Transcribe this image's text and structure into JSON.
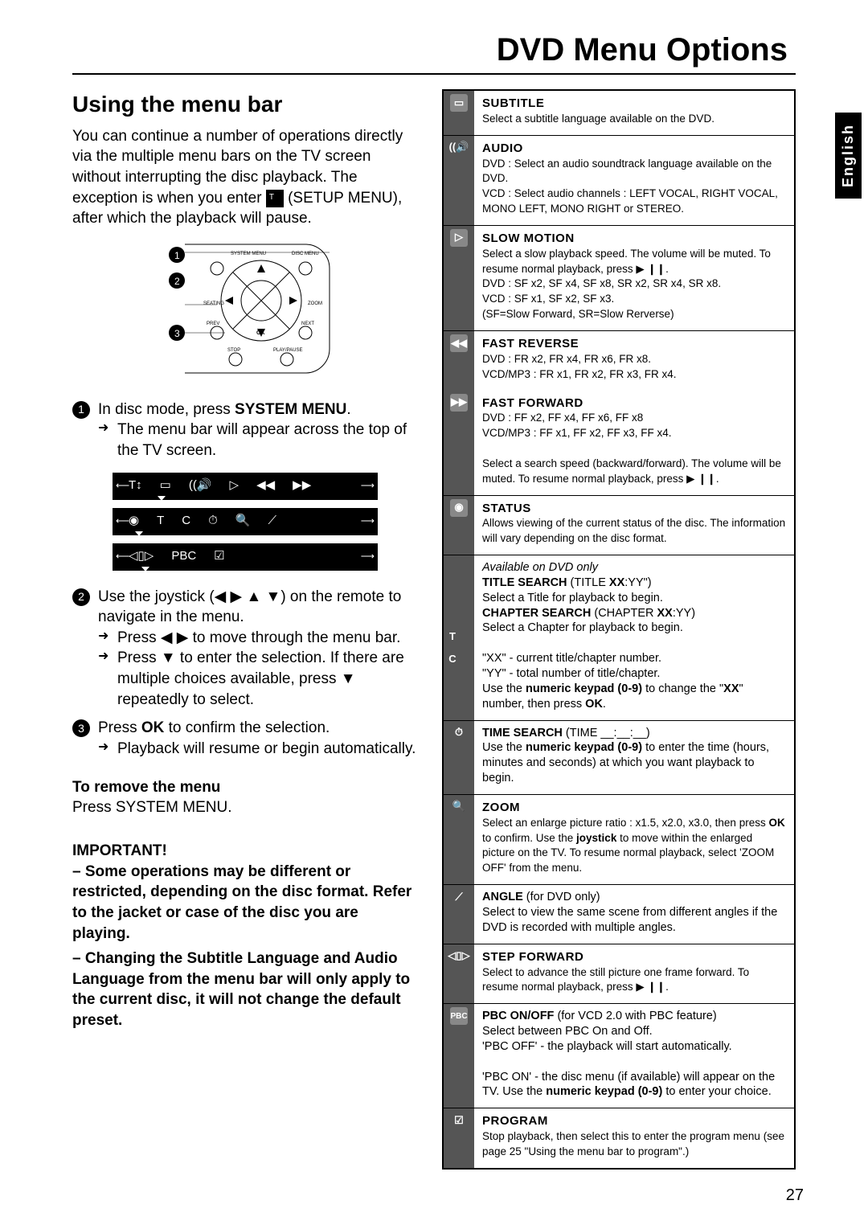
{
  "page_title": "DVD Menu Options",
  "lang_tab": "English",
  "page_number": "27",
  "left": {
    "heading": "Using the menu bar",
    "intro_a": "You can continue a number of operations directly via the multiple menu bars on the TV screen without interrupting the disc playback. The exception is when you enter ",
    "intro_b": " (SETUP MENU), after which the playback will pause.",
    "remote_labels": {
      "sys": "SYSTEM MENU",
      "disc": "DISC MENU",
      "seating": "SEATING",
      "zoom": "ZOOM",
      "prev": "PREV",
      "next": "NEXT",
      "ok": "OK",
      "stop": "STOP",
      "play": "PLAY/PAUSE"
    },
    "step1_a": "In disc mode, press ",
    "step1_a_bold": "SYSTEM MENU",
    "step1_a_end": ".",
    "step1_b": "The menu bar will appear across the top of the TV screen.",
    "step2_a_pre": "Use the joystick (",
    "step2_a_post": ") on the remote to navigate in the menu.",
    "step2_arrows": "◀ ▶ ▲ ▼",
    "step2_b": "Press ◀ ▶ to move through the menu bar.",
    "step2_c": "Press ▼ to enter the selection. If there are multiple choices available, press ▼ repeatedly to select.",
    "step3_a_pre": "Press ",
    "step3_a_bold": "OK",
    "step3_a_post": " to confirm the selection.",
    "step3_b": "Playback will resume or begin automatically.",
    "remove_h": "To remove the menu",
    "remove_body": "Press SYSTEM MENU.",
    "important_h": "IMPORTANT!",
    "important_1": "– Some operations may be different or restricted, depending on the disc format. Refer to the jacket or case of the disc you are playing.",
    "important_2": "– Changing the Subtitle Language and Audio Language from the menu bar will only apply to the current disc, it will not change the default preset."
  },
  "bars": {
    "row1": [
      "T↕",
      "▭",
      "((🔊",
      "▷",
      "◀◀",
      "▶▶"
    ],
    "row2": [
      "◉",
      "T",
      "C",
      "⏱",
      "🔍",
      "⟋"
    ],
    "row3": [
      "◁▯▷",
      "PBC",
      "☑"
    ]
  },
  "options": [
    {
      "icon": "▭",
      "title": "SUBTITLE",
      "body": "Select a subtitle language available on the DVD."
    },
    {
      "icon": "((🔊",
      "title": "AUDIO",
      "body": "DVD : Select an audio soundtrack language available on the DVD.\nVCD : Select audio channels : LEFT VOCAL, RIGHT VOCAL, MONO LEFT, MONO RIGHT or STEREO."
    },
    {
      "icon": "▷",
      "title": "SLOW MOTION",
      "body": "Select a slow playback speed. The volume will be muted. To resume normal playback, press ▶ ❙❙.\nDVD : SF x2, SF x4, SF x8, SR x2, SR x4, SR x8.\nVCD : SF x1, SF x2, SF x3.\n      (SF=Slow Forward, SR=Slow Rerverse)"
    },
    {
      "icon": "◀◀",
      "title": "FAST REVERSE",
      "body": "DVD : FR x2, FR x4, FR x6, FR x8.\nVCD/MP3 : FR x1, FR x2, FR x3, FR x4.",
      "noline": true
    },
    {
      "icon": "▶▶",
      "title": "FAST FORWARD",
      "body": "DVD : FF x2, FF x4, FF x6, FF x8\nVCD/MP3 : FF x1, FF x2, FF x3, FF x4.\n\nSelect a search speed (backward/forward). The volume will be muted. To resume normal playback, press ▶ ❙❙."
    },
    {
      "icon": "◉",
      "title": "STATUS",
      "body": "Allows viewing of the current status of the disc. The information will vary depending on the disc format."
    },
    {
      "icon": "TC",
      "title_html": true,
      "body": ""
    },
    {
      "icon": "⏱",
      "title": "",
      "body": ""
    },
    {
      "icon": "🔍",
      "title": "ZOOM",
      "body": "Select an enlarge picture ratio : x1.5, x2.0, x3.0, then press <b>OK</b> to confirm. Use the <b>joystick</b> to move within the enlarged picture on the TV. To resume normal playback, select 'ZOOM OFF' from the menu."
    },
    {
      "icon": "⟋",
      "title": "",
      "body": "<b>ANGLE</b> (for DVD only)\nSelect to view the same scene from different angles if the DVD is recorded with multiple angles."
    },
    {
      "icon": "◁▯▷",
      "title": "STEP FORWARD",
      "body": "Select to advance the still picture one frame forward. To resume normal playback, press ▶ ❙❙."
    },
    {
      "icon": "PBC",
      "title": "",
      "body": "<b>PBC ON/OFF</b> (for VCD 2.0 with PBC feature)\nSelect between PBC On and Off.\n'PBC OFF' - the playback will start automatically.\n\n'PBC ON' - the disc menu (if available) will appear on the TV. Use the <b>numeric keypad (0-9)</b> to enter your choice."
    },
    {
      "icon": "☑",
      "title": "PROGRAM",
      "body": "Stop playback, then select this to enter the program menu (see page 25 \"Using the menu bar to program\".)"
    }
  ],
  "tc": {
    "avail": "Available on DVD only",
    "title_search": "TITLE SEARCH",
    "title_search_fmt": " (TITLE XX:YY\")",
    "title_search_body": "Select a Title for playback to begin.",
    "chapter_search": "CHAPTER SEARCH",
    "chapter_search_fmt": " (CHAPTER XX:YY)",
    "chapter_search_body": "Select a Chapter for playback to begin.",
    "xx": "\"XX\" - current title/chapter number.",
    "yy": "\"YY\" - total number of title/chapter.",
    "kp": "Use the numeric keypad (0-9) to change the \"XX\" number, then press OK."
  },
  "time_search": {
    "title": "TIME SEARCH",
    "fmt": " (TIME __:__:__)",
    "body": "Use the <b>numeric keypad (0-9)</b> to enter the time (hours, minutes and seconds) at which you want playback to begin."
  }
}
